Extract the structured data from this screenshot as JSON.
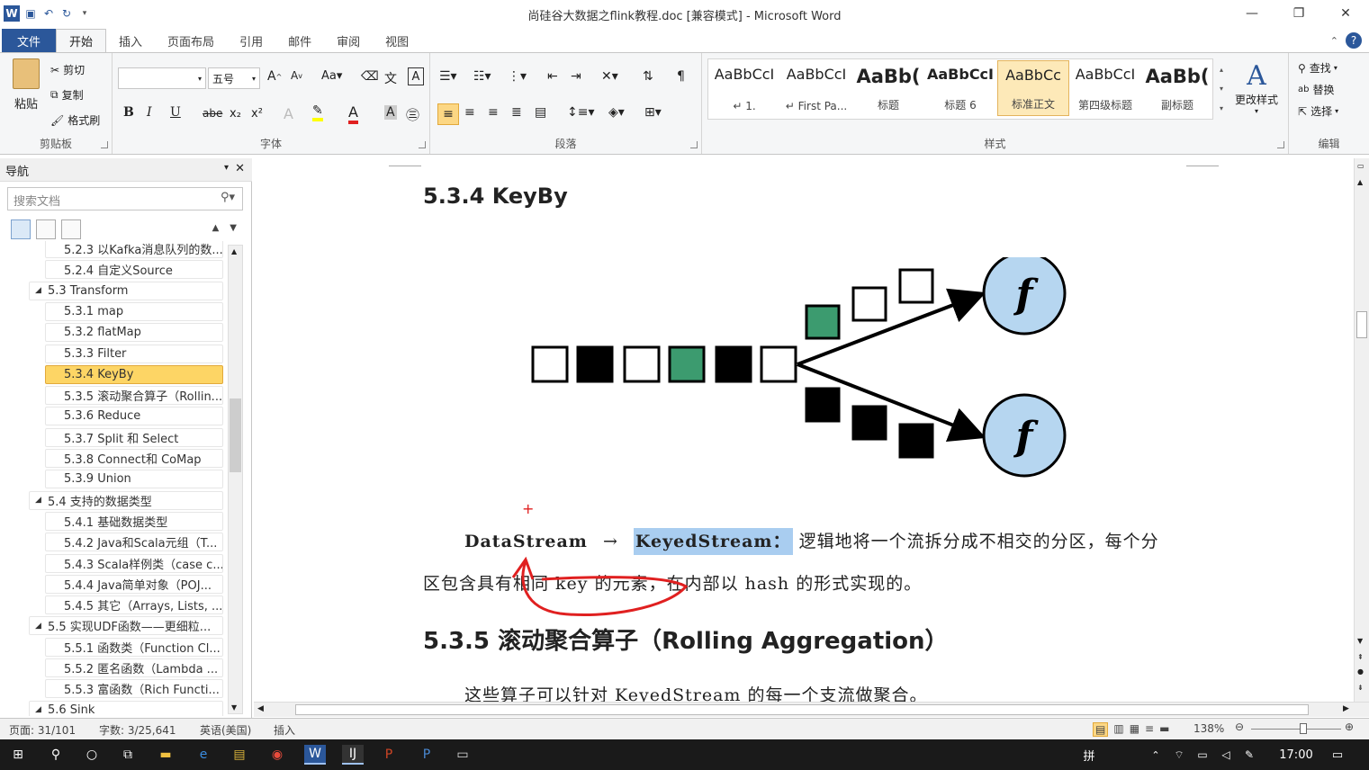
{
  "window": {
    "title": "尚硅谷大数据之flink教程.doc [兼容模式] - Microsoft Word",
    "buttons": [
      "—",
      "❐",
      "✕"
    ]
  },
  "ribbon_tabs": [
    "文件",
    "开始",
    "插入",
    "页面布局",
    "引用",
    "邮件",
    "审阅",
    "视图"
  ],
  "clipboard": {
    "paste": "粘贴",
    "cut": "剪切",
    "copy": "复制",
    "format_painter": "格式刷",
    "label": "剪贴板"
  },
  "font": {
    "name": "",
    "size": "五号",
    "label": "字体",
    "buttons": [
      "B",
      "I",
      "U",
      "abe",
      "x₂",
      "x²"
    ]
  },
  "paragraph": {
    "label": "段落"
  },
  "styles": {
    "label": "样式",
    "items": [
      {
        "preview": "AaBbCcI",
        "name": "↵ 1."
      },
      {
        "preview": "AaBbCcI",
        "name": "↵ First Pa..."
      },
      {
        "preview": "AaBb(",
        "name": "标题"
      },
      {
        "preview": "AaBbCcI",
        "name": "标题 6"
      },
      {
        "preview": "AaBbCc",
        "name": "标准正文"
      },
      {
        "preview": "AaBbCcI",
        "name": "第四级标题"
      },
      {
        "preview": "AaBb(",
        "name": "副标题"
      }
    ],
    "change_styles": "更改样式"
  },
  "editing": {
    "find": "查找",
    "replace": "替换",
    "select": "选择",
    "label": "编辑"
  },
  "nav": {
    "title": "导航",
    "search_placeholder": "搜索文档",
    "items": [
      {
        "label": "5.2.3 以Kafka消息队列的数...",
        "level": 2
      },
      {
        "label": "5.2.4 自定义Source",
        "level": 2
      },
      {
        "label": "5.3 Transform",
        "level": 1
      },
      {
        "label": "5.3.1 map",
        "level": 2
      },
      {
        "label": "5.3.2 flatMap",
        "level": 2
      },
      {
        "label": "5.3.3 Filter",
        "level": 2
      },
      {
        "label": "5.3.4 KeyBy",
        "level": 2,
        "selected": true
      },
      {
        "label": "5.3.5 滚动聚合算子（Rollin...",
        "level": 2
      },
      {
        "label": "5.3.6 Reduce",
        "level": 2
      },
      {
        "label": "5.3.7 Split 和 Select",
        "level": 2
      },
      {
        "label": "5.3.8 Connect和 CoMap",
        "level": 2
      },
      {
        "label": "5.3.9 Union",
        "level": 2
      },
      {
        "label": "5.4 支持的数据类型",
        "level": 1
      },
      {
        "label": "5.4.1 基础数据类型",
        "level": 2
      },
      {
        "label": "5.4.2 Java和Scala元组（T...",
        "level": 2
      },
      {
        "label": "5.4.3 Scala样例类（case c...",
        "level": 2
      },
      {
        "label": "5.4.4 Java简单对象（POJ...",
        "level": 2
      },
      {
        "label": "5.4.5 其它（Arrays, Lists, ...",
        "level": 2
      },
      {
        "label": "5.5 实现UDF函数——更细粒...",
        "level": 1
      },
      {
        "label": "5.5.1 函数类（Function Cl...",
        "level": 2
      },
      {
        "label": "5.5.2 匿名函数（Lambda ...",
        "level": 2
      },
      {
        "label": "5.5.3 富函数（Rich Functi...",
        "level": 2
      },
      {
        "label": "5.6 Sink",
        "level": 1
      }
    ]
  },
  "document": {
    "heading1": "5.3.4 KeyBy",
    "diagram_function_label": "f",
    "para_lead": "DataStream",
    "para_arrow": "→",
    "para_highlight": "KeyedStream：",
    "para_rest": "逻辑地将一个流拆分成不相交的分区，每个分",
    "para_line2": "区包含具有相同 key 的元素，在内部以 hash 的形式实现的。",
    "heading2": "5.3.5  滚动聚合算子（Rolling Aggregation）",
    "para3": "这些算子可以针对 KeyedStream 的每一个支流做聚合。"
  },
  "statusbar": {
    "page": "页面: 31/101",
    "words": "字数: 3/25,641",
    "lang": "英语(美国)",
    "mode": "插入",
    "zoom": "138%"
  },
  "taskbar": {
    "time": "17:00",
    "ime": "拼"
  },
  "colors": {
    "word_blue": "#2b579a",
    "nav_selected": "#fdd565",
    "green_square": "#3c9b6f",
    "circle_fill": "#b6d6f0",
    "annotation_red": "#e02020"
  }
}
